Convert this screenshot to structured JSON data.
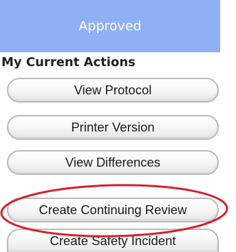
{
  "status": {
    "label": "Approved",
    "color": "#8fb0f5"
  },
  "actions": {
    "title": "My Current Actions",
    "buttons": [
      {
        "label": "View Protocol"
      },
      {
        "label": "Printer Version"
      },
      {
        "label": "View Differences"
      },
      {
        "label": "Create Continuing Review"
      },
      {
        "label": "Create Safety Incident"
      }
    ]
  },
  "highlight": {
    "target": "Create Continuing Review",
    "color": "#d81e2a"
  }
}
